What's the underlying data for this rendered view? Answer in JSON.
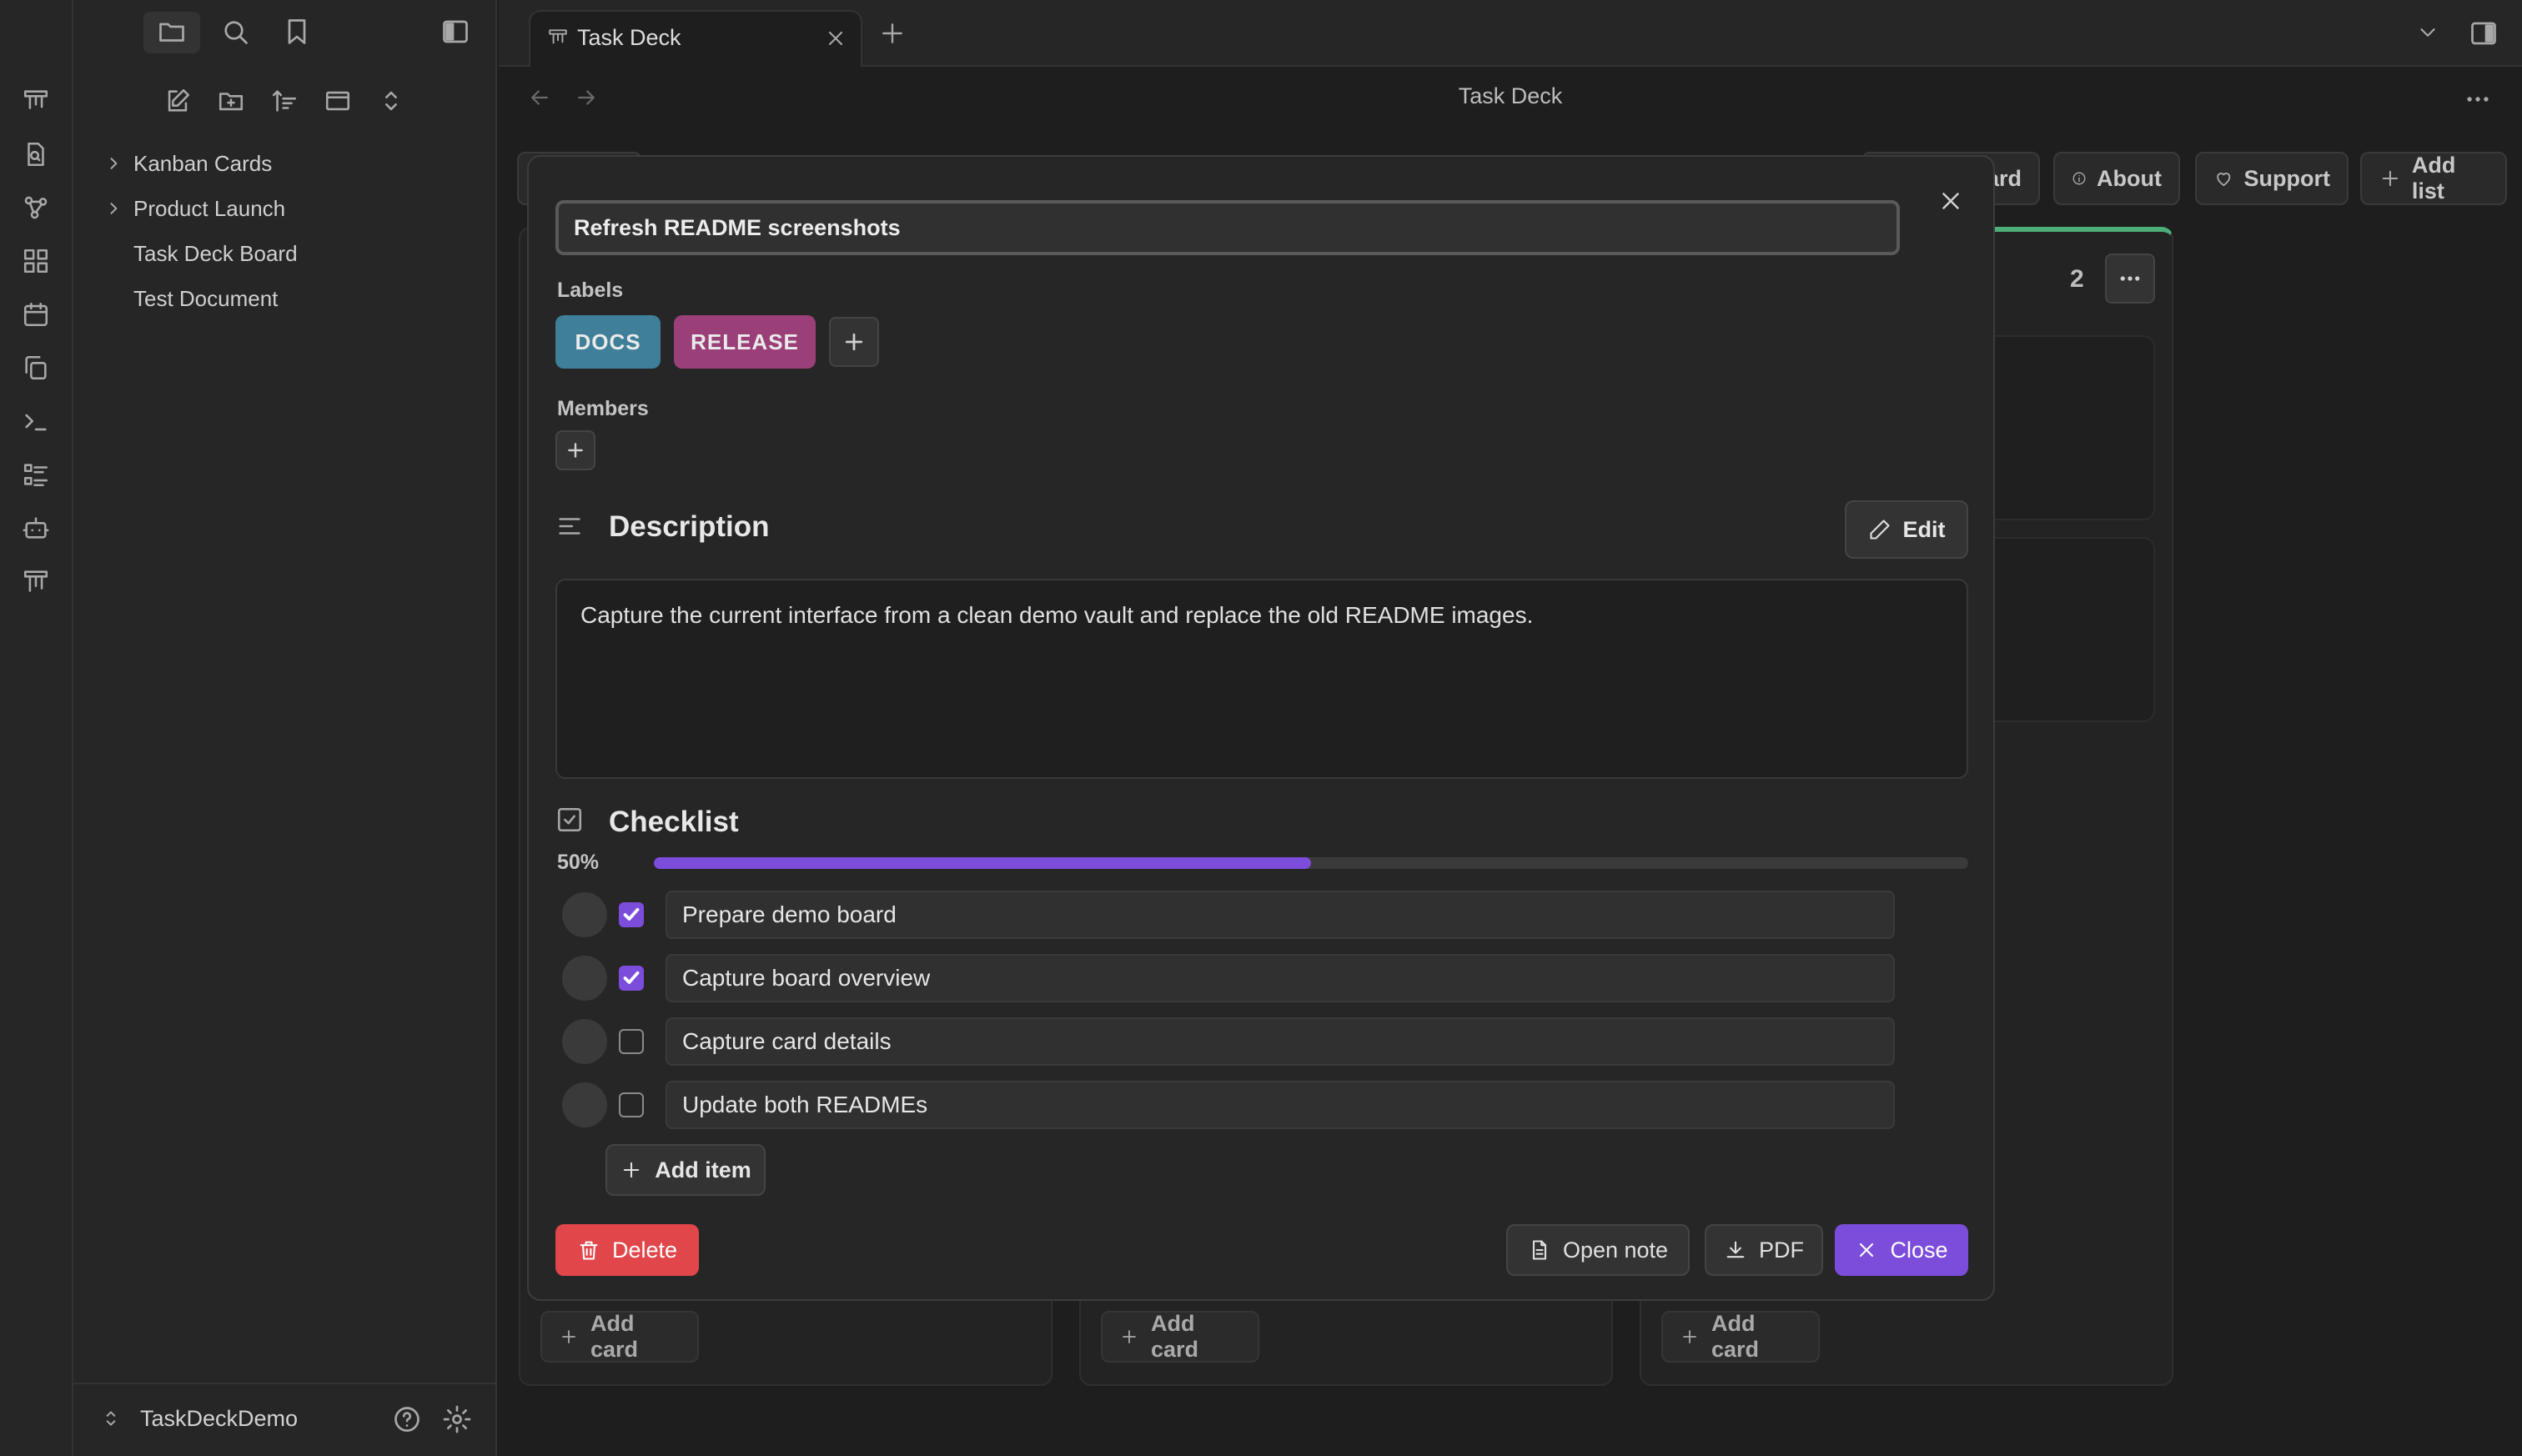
{
  "app": {
    "title": "Task Deck",
    "tab_label": "Task Deck",
    "vault_name": "TaskDeckDemo"
  },
  "sidebar": {
    "items": [
      {
        "label": "Kanban Cards",
        "collapsible": true
      },
      {
        "label": "Product Launch",
        "collapsible": true
      },
      {
        "label": "Task Deck Board",
        "collapsible": false
      },
      {
        "label": "Test Document",
        "collapsible": false
      }
    ]
  },
  "board": {
    "toolbar": {
      "board_label": "ard",
      "about_label": "About",
      "support_label": "Support",
      "add_list_label": "Add list"
    },
    "lane_count": "2",
    "add_card_label": "Add card"
  },
  "modal": {
    "title_value": "Refresh README screenshots",
    "labels_heading": "Labels",
    "labels": [
      {
        "text": "DOCS",
        "color": "#3f7f99"
      },
      {
        "text": "RELEASE",
        "color": "#9b3f79"
      }
    ],
    "members_heading": "Members",
    "description_heading": "Description",
    "edit_label": "Edit",
    "description_text": "Capture the current interface from a clean demo vault and replace the old README images.",
    "checklist_heading": "Checklist",
    "progress_label": "50%",
    "progress_fraction": 0.5,
    "checklist": [
      {
        "text": "Prepare demo board",
        "checked": true
      },
      {
        "text": "Capture board overview",
        "checked": true
      },
      {
        "text": "Capture card details",
        "checked": false
      },
      {
        "text": "Update both READMEs",
        "checked": false
      }
    ],
    "add_item_label": "Add item",
    "delete_label": "Delete",
    "open_note_label": "Open note",
    "pdf_label": "PDF",
    "close_label": "Close"
  },
  "colors": {
    "accent": "#7c4ddb",
    "danger": "#e0464a",
    "lane_top_green": "#4caf7a"
  }
}
